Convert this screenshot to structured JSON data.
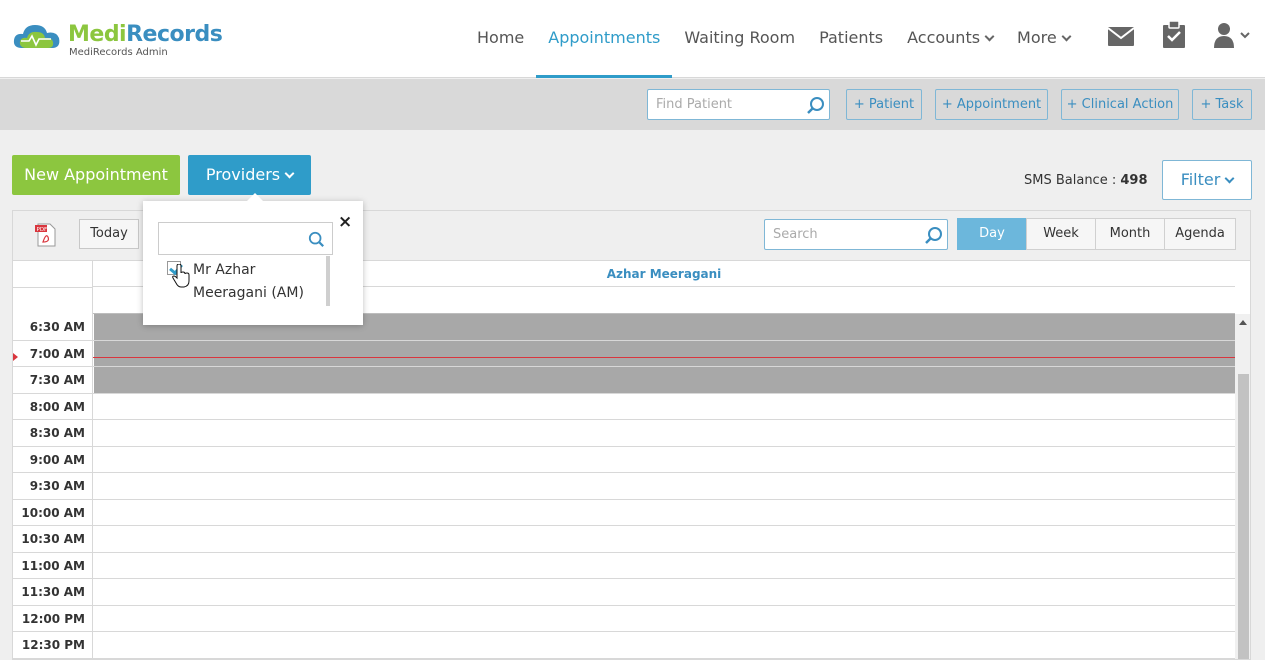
{
  "header": {
    "brand_part1": "Medi",
    "brand_part2": "Records",
    "brand_sub": "MediRecords Admin",
    "nav": [
      {
        "label": "Home"
      },
      {
        "label": "Appointments",
        "active": true
      },
      {
        "label": "Waiting Room"
      },
      {
        "label": "Patients"
      },
      {
        "label": "Accounts",
        "dropdown": true
      },
      {
        "label": "More",
        "dropdown": true
      }
    ],
    "icons": [
      "mail-icon",
      "clipboard-check-icon",
      "user-icon"
    ]
  },
  "quickbar": {
    "find_placeholder": "Find Patient",
    "add_patient": "+ Patient",
    "add_appointment": "+ Appointment",
    "add_clinical_action": "+ Clinical Action",
    "add_task": "+ Task"
  },
  "toolbar": {
    "new_appointment": "New Appointment",
    "providers": "Providers",
    "sms_label": "SMS Balance : ",
    "sms_value": "498",
    "filter": "Filter"
  },
  "calendar": {
    "today": "Today",
    "search_placeholder": "Search",
    "views": [
      "Day",
      "Week",
      "Month",
      "Agenda"
    ],
    "active_view": "Day",
    "provider": "Azhar Meeragani",
    "times": [
      "6:30 AM",
      "7:00 AM",
      "7:30 AM",
      "8:00 AM",
      "8:30 AM",
      "9:00 AM",
      "9:30 AM",
      "10:00 AM",
      "10:30 AM",
      "11:00 AM",
      "11:30 AM",
      "12:00 PM",
      "12:30 PM"
    ],
    "closed_slots": [
      "6:30 AM",
      "7:00 AM",
      "7:30 AM"
    ]
  },
  "provider_popup": {
    "search_value": "",
    "close": "×",
    "items": [
      {
        "label": "Mr Azhar Meeragani (AM)",
        "checked": true
      }
    ]
  },
  "colors": {
    "accent": "#2f9cc9",
    "green": "#8cc63f",
    "closed": "#a8a8a8",
    "now_line": "#d9363e"
  }
}
